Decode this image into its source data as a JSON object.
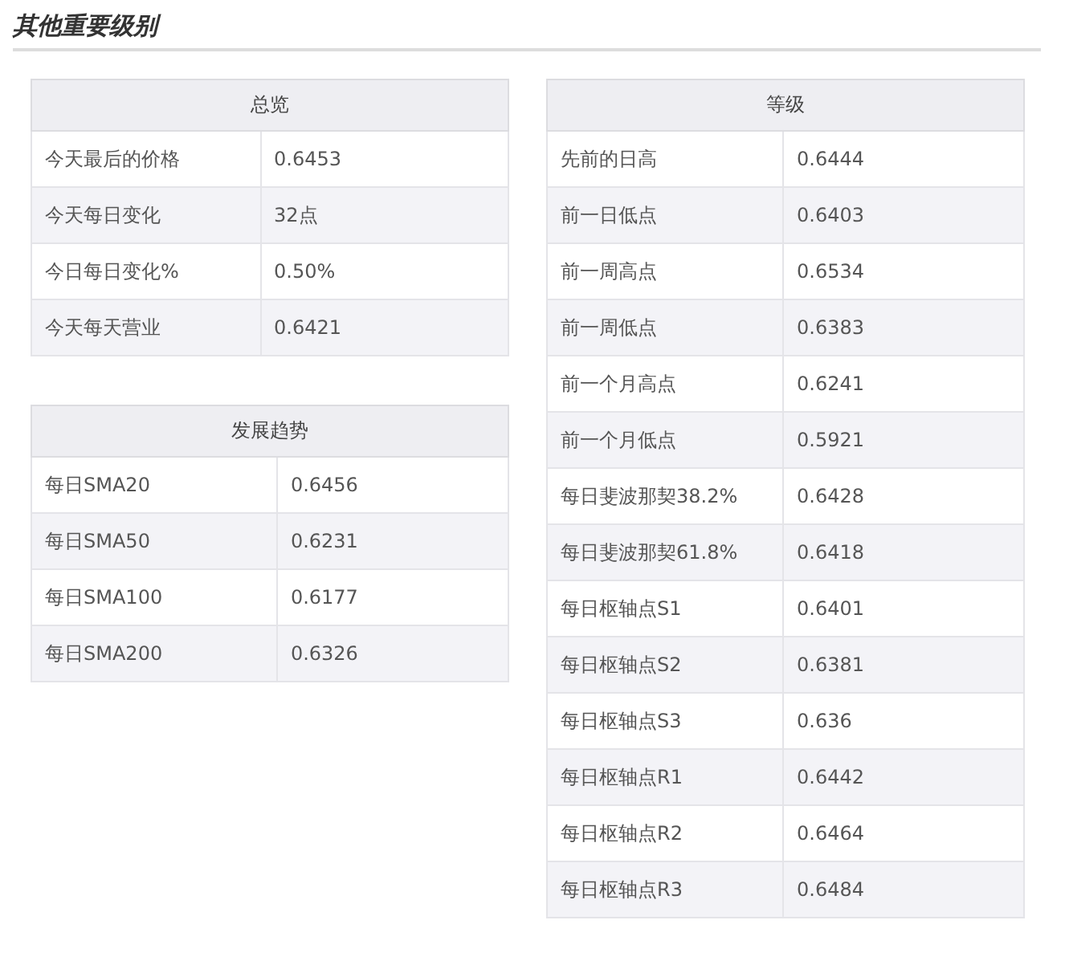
{
  "heading": "其他重要级别",
  "tables": [
    {
      "title": "总览",
      "rows": [
        {
          "label": "今天最后的价格",
          "value": "0.6453"
        },
        {
          "label": "今天每日变化",
          "value": "32点"
        },
        {
          "label": "今日每日变化%",
          "value": "0.50%"
        },
        {
          "label": "今天每天营业",
          "value": "0.6421"
        }
      ]
    },
    {
      "title": "发展趋势",
      "rows": [
        {
          "label": "每日SMA20",
          "value": "0.6456"
        },
        {
          "label": "每日SMA50",
          "value": "0.6231"
        },
        {
          "label": "每日SMA100",
          "value": "0.6177"
        },
        {
          "label": "每日SMA200",
          "value": "0.6326"
        }
      ]
    },
    {
      "title": "等级",
      "rows": [
        {
          "label": "先前的日高",
          "value": "0.6444"
        },
        {
          "label": "前一日低点",
          "value": "0.6403"
        },
        {
          "label": "前一周高点",
          "value": "0.6534"
        },
        {
          "label": "前一周低点",
          "value": "0.6383"
        },
        {
          "label": "前一个月高点",
          "value": "0.6241"
        },
        {
          "label": "前一个月低点",
          "value": "0.5921"
        },
        {
          "label": "每日斐波那契38.2%",
          "value": "0.6428"
        },
        {
          "label": "每日斐波那契61.8%",
          "value": "0.6418"
        },
        {
          "label": "每日枢轴点S1",
          "value": "0.6401"
        },
        {
          "label": "每日枢轴点S2",
          "value": "0.6381"
        },
        {
          "label": "每日枢轴点S3",
          "value": "0.636"
        },
        {
          "label": "每日枢轴点R1",
          "value": "0.6442"
        },
        {
          "label": "每日枢轴点R2",
          "value": "0.6464"
        },
        {
          "label": "每日枢轴点R3",
          "value": "0.6484"
        }
      ]
    }
  ]
}
